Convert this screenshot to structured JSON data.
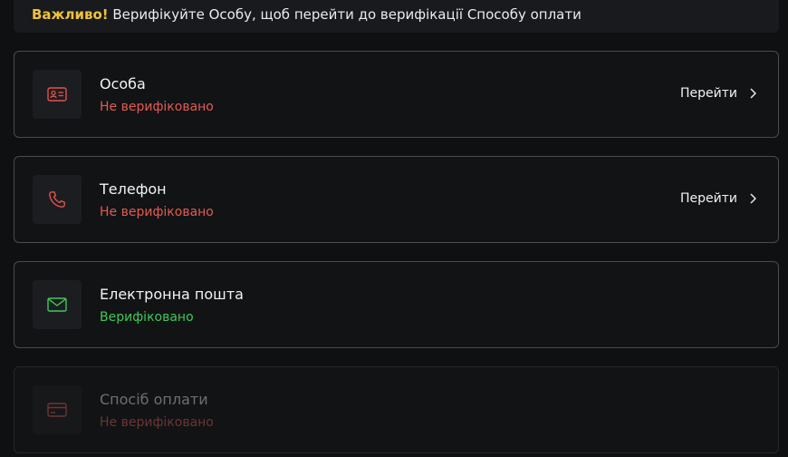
{
  "notice": {
    "label": "Важливо!",
    "message": " Верифікуйте Особу, щоб перейти до верифікації Способу оплати"
  },
  "items": [
    {
      "title": "Особа",
      "status": "Не верифіковано",
      "action": "Перейти",
      "icon": "id-card-icon"
    },
    {
      "title": "Телефон",
      "status": "Не верифіковано",
      "action": "Перейти",
      "icon": "phone-icon"
    },
    {
      "title": "Електронна пошта",
      "status": "Верифіковано",
      "icon": "envelope-icon"
    },
    {
      "title": "Спосіб оплати",
      "status": "Не верифіковано",
      "icon": "credit-card-icon",
      "disabled": true
    }
  ],
  "colors": {
    "accent_warning": "#f0c23c",
    "status_unverified": "#e35a52",
    "status_verified": "#3fc95a"
  }
}
